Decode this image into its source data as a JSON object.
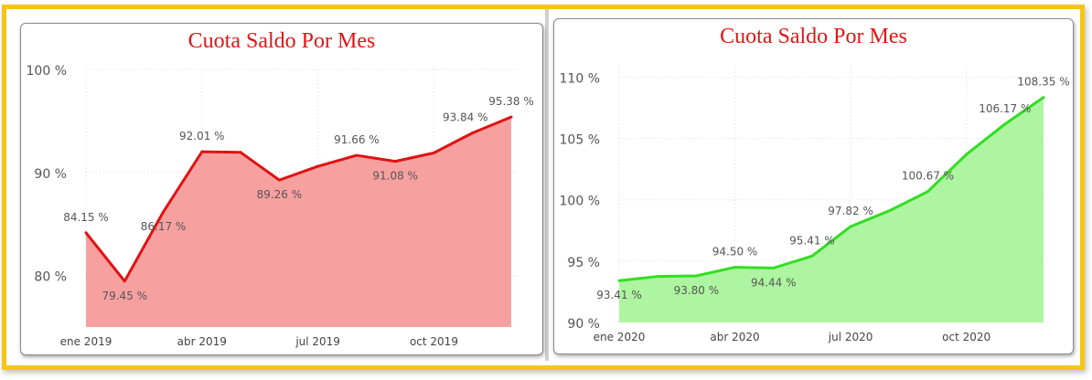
{
  "chart_data": [
    {
      "type": "area",
      "title": "Cuota Saldo Por Mes",
      "xlabel": "",
      "ylabel": "",
      "y_unit": "%",
      "ylim": [
        75,
        100
      ],
      "y_ticks": [
        80,
        90,
        100
      ],
      "y_tick_labels": [
        "80 %",
        "90 %",
        "100 %"
      ],
      "x_tick_labels": [
        "ene 2019",
        "abr 2019",
        "jul 2019",
        "oct 2019"
      ],
      "categories": [
        "ene 2019",
        "feb 2019",
        "mar 2019",
        "abr 2019",
        "may 2019",
        "jun 2019",
        "jul 2019",
        "ago 2019",
        "sep 2019",
        "oct 2019",
        "nov 2019",
        "dic 2019"
      ],
      "values": [
        84.15,
        79.45,
        86.17,
        92.01,
        91.95,
        89.26,
        90.6,
        91.66,
        91.08,
        91.9,
        93.84,
        95.38
      ],
      "data_labels": [
        "84.15 %",
        "79.45 %",
        "86.17 %",
        "92.01 %",
        "",
        "89.26 %",
        "",
        "91.66 %",
        "91.08 %",
        "",
        "93.84 %",
        "95.38 %"
      ],
      "colors": {
        "line": "#e01212",
        "fill": "#f7a0a0"
      },
      "grid": true,
      "legend": "none"
    },
    {
      "type": "area",
      "title": "Cuota Saldo Por Mes",
      "xlabel": "",
      "ylabel": "",
      "y_unit": "%",
      "ylim": [
        90,
        111
      ],
      "y_ticks": [
        90,
        95,
        100,
        105,
        110
      ],
      "y_tick_labels": [
        "90 %",
        "95 %",
        "100 %",
        "105 %",
        "110 %"
      ],
      "x_tick_labels": [
        "ene 2020",
        "abr 2020",
        "jul 2020",
        "oct 2020"
      ],
      "categories": [
        "ene 2020",
        "feb 2020",
        "mar 2020",
        "abr 2020",
        "may 2020",
        "jun 2020",
        "jul 2020",
        "ago 2020",
        "sep 2020",
        "oct 2020",
        "nov 2020",
        "dic 2020"
      ],
      "values": [
        93.41,
        93.75,
        93.8,
        94.5,
        94.44,
        95.41,
        97.82,
        99.1,
        100.67,
        103.7,
        106.17,
        108.35
      ],
      "data_labels": [
        "93.41 %",
        "",
        "93.80 %",
        "94.50 %",
        "94.44 %",
        "95.41 %",
        "97.82 %",
        "",
        "100.67 %",
        "",
        "106.17 %",
        "108.35 %"
      ],
      "colors": {
        "line": "#33dd22",
        "fill": "#adf5a0"
      },
      "grid": true,
      "legend": "none"
    }
  ]
}
